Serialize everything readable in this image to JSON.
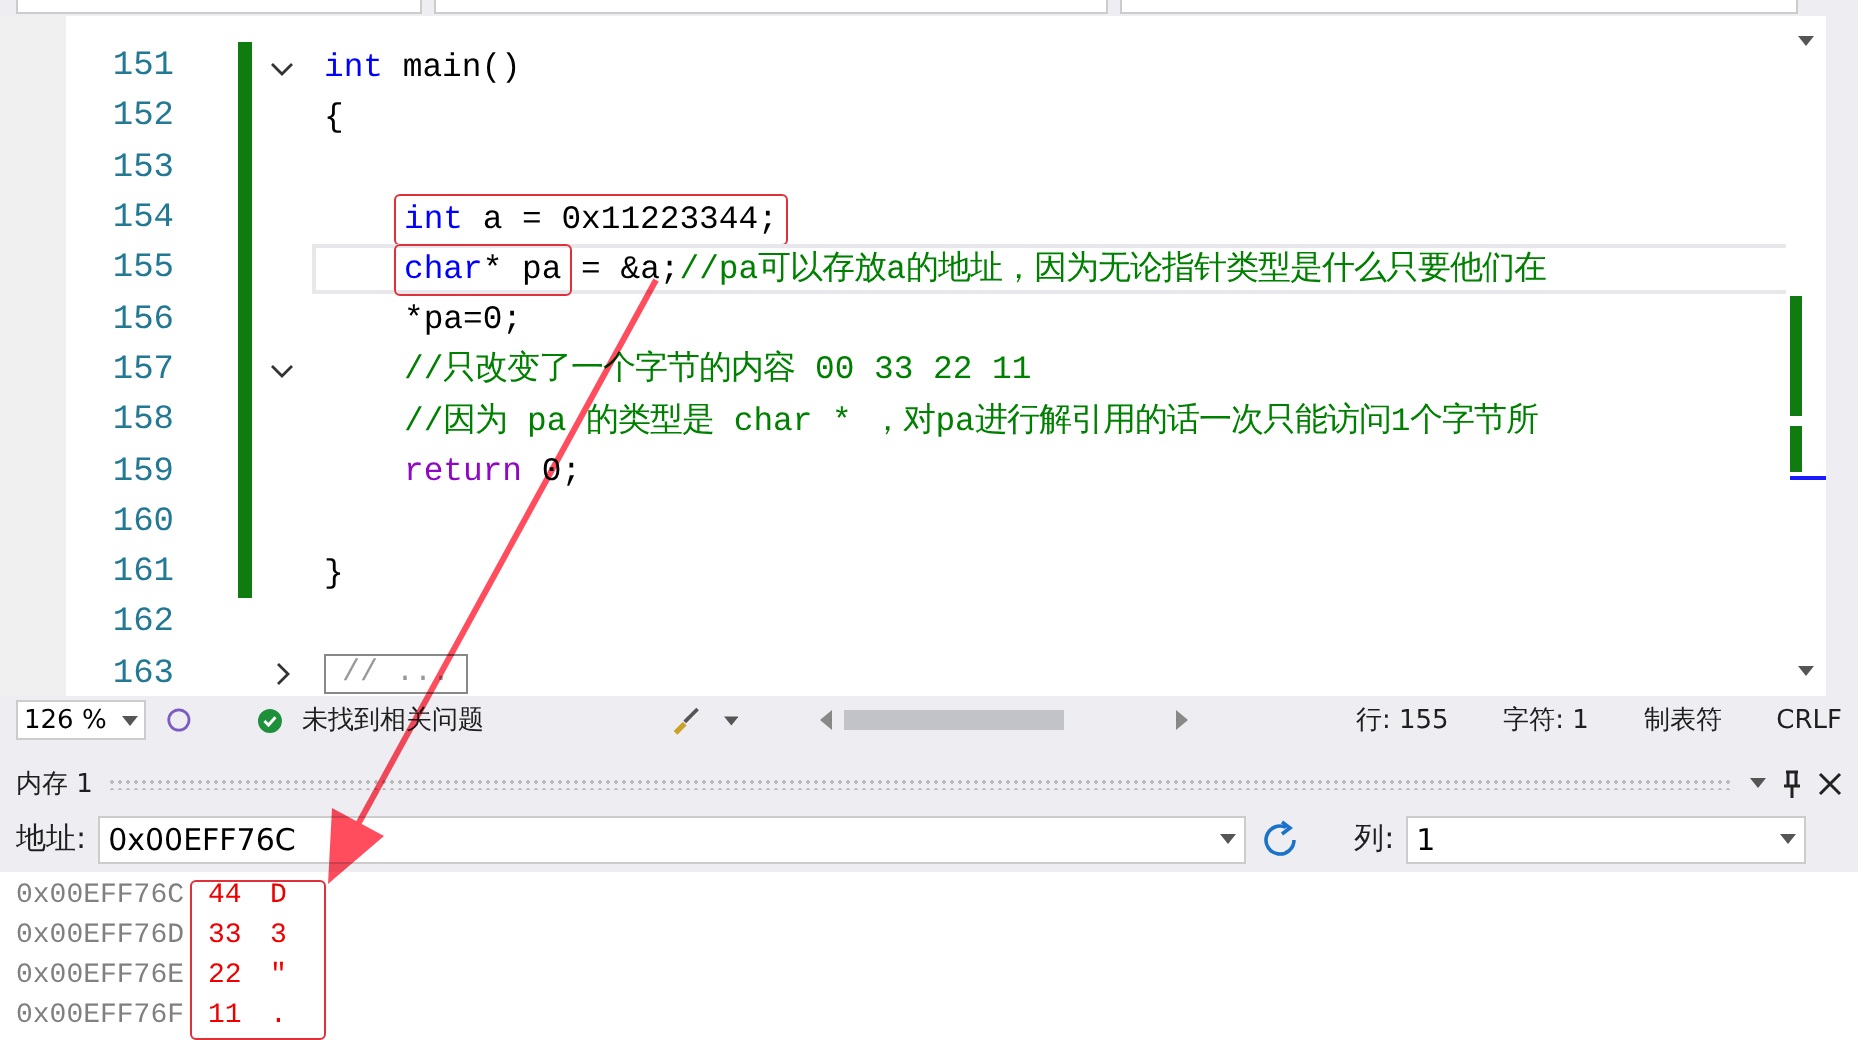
{
  "editor": {
    "lines": [
      {
        "number": "151",
        "changed": true,
        "current": false,
        "expanded": true,
        "tokens": [
          {
            "text": "int",
            "kind": "keyword"
          },
          {
            "text": " main()",
            "kind": "plain"
          }
        ]
      },
      {
        "number": "152",
        "changed": true,
        "current": false,
        "tokens": [
          {
            "text": "{",
            "kind": "plain"
          }
        ]
      },
      {
        "number": "153",
        "changed": true,
        "current": false
      },
      {
        "number": "154",
        "changed": true,
        "current": false,
        "indented": true,
        "tokens": [
          {
            "text": "int",
            "kind": "keyword",
            "boxed": true
          },
          {
            "text": " a = 0x11223344;",
            "kind": "plain",
            "boxed": true
          }
        ]
      },
      {
        "number": "155",
        "changed": true,
        "current": true,
        "indented": true,
        "tokens": [
          {
            "text": "char",
            "kind": "keyword",
            "boxed": true
          },
          {
            "text": "* pa",
            "kind": "plain",
            "boxed": true
          },
          {
            "text": " = &a;",
            "kind": "plain",
            "boxed": false
          },
          {
            "text": "//pa可以存放a的地址，因为无论指针类型是什么只要他们在",
            "kind": "comment"
          }
        ]
      },
      {
        "number": "156",
        "changed": true,
        "current": false,
        "indented": true,
        "tokens": [
          {
            "text": "*pa=0;",
            "kind": "plain"
          }
        ]
      },
      {
        "number": "157",
        "changed": true,
        "current": false,
        "expanded": true,
        "indented": true,
        "tokens": [
          {
            "text": "//只改变了一个字节的内容 00 33 22 11",
            "kind": "comment"
          }
        ]
      },
      {
        "number": "158",
        "changed": true,
        "current": false,
        "indented": true,
        "tokens": [
          {
            "text": "//因为 pa 的类型是 char * ，对pa进行解引用的话一次只能访问1个字节所",
            "kind": "comment"
          }
        ]
      },
      {
        "number": "159",
        "changed": true,
        "current": false,
        "indented": true,
        "tokens": [
          {
            "text": "return",
            "kind": "control"
          },
          {
            "text": " 0;",
            "kind": "plain"
          }
        ]
      },
      {
        "number": "160",
        "changed": true,
        "current": false
      },
      {
        "number": "161",
        "changed": true,
        "current": false,
        "tokens": [
          {
            "text": "}",
            "kind": "plain"
          }
        ]
      },
      {
        "number": "162",
        "changed": false,
        "current": false
      },
      {
        "number": "163",
        "changed": false,
        "current": false,
        "expanded": false,
        "collapsed_text": "// ..."
      }
    ]
  },
  "status_bar": {
    "zoom": "126 %",
    "issues": "未找到相关问题",
    "line": "行: 155",
    "char": "字符: 1",
    "indent": "制表符",
    "line_ending": "CRLF"
  },
  "memory": {
    "title": "内存 1",
    "address_label": "地址:",
    "address": "0x00EFF76C",
    "columns_label": "列:",
    "columns": "1",
    "rows": [
      {
        "address": "0x00EFF76C",
        "value": "44",
        "char": "D"
      },
      {
        "address": "0x00EFF76D",
        "value": "33",
        "char": "3"
      },
      {
        "address": "0x00EFF76E",
        "value": "22",
        "char": "\""
      },
      {
        "address": "0x00EFF76F",
        "value": "11",
        "char": "."
      }
    ]
  }
}
